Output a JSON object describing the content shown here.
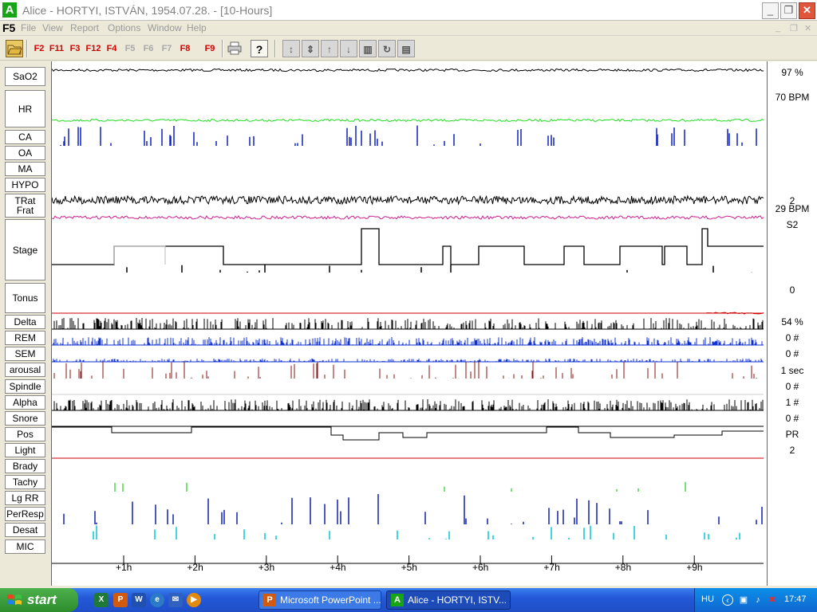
{
  "window": {
    "app_icon": "A",
    "title": "Alice - HORTYI, ISTVÁN, 1954.07.28.  - [10-Hours]",
    "minimize": "_",
    "maximize": "❐",
    "close": "✕"
  },
  "menu": {
    "f5": "F5",
    "items": [
      "File",
      "View",
      "Report",
      "Options",
      "Window",
      "Help"
    ],
    "mdi_controls": [
      "_",
      "❐",
      "✕"
    ]
  },
  "toolbar": {
    "open_icon": "folder-open-icon",
    "fkeys": [
      {
        "label": "F2",
        "enabled": true
      },
      {
        "label": "F11",
        "enabled": true
      },
      {
        "label": "F3",
        "enabled": true
      },
      {
        "label": "F12",
        "enabled": true
      },
      {
        "label": "F4",
        "enabled": true
      },
      {
        "label": "F5",
        "enabled": false
      },
      {
        "label": "F6",
        "enabled": false
      },
      {
        "label": "F7",
        "enabled": false
      },
      {
        "label": "F8",
        "enabled": true
      },
      {
        "label": "F9",
        "enabled": true
      }
    ],
    "print_icon": "printer-icon",
    "help_label": "?",
    "nav_icons": [
      "expand-icon",
      "compress-icon",
      "move-up-icon",
      "move-down-icon",
      "columns-icon",
      "refresh-icon",
      "layout-icon"
    ]
  },
  "channels": [
    {
      "label": "SaO2"
    },
    {
      "label": "HR"
    },
    {
      "label": "CA"
    },
    {
      "label": "OA"
    },
    {
      "label": "MA"
    },
    {
      "label": "HYPO"
    },
    {
      "label": "TRat\nFrat"
    },
    {
      "label": "Stage"
    },
    {
      "label": "Tonus"
    },
    {
      "label": "Delta"
    },
    {
      "label": "REM"
    },
    {
      "label": "SEM"
    },
    {
      "label": "arousal"
    },
    {
      "label": "Spindle"
    },
    {
      "label": "Alpha"
    },
    {
      "label": "Snore"
    },
    {
      "label": "Pos"
    },
    {
      "label": "Light"
    },
    {
      "label": "Brady"
    },
    {
      "label": "Tachy"
    },
    {
      "label": "Lg RR"
    },
    {
      "label": "PerResp"
    },
    {
      "label": "Desat"
    },
    {
      "label": "MIC"
    }
  ],
  "readouts": {
    "sao2": "97 %",
    "hr": "70 BPM",
    "trat_top": "2",
    "trat": "29 BPM",
    "stage": "S2",
    "tonus": "0",
    "delta": "54 %",
    "rem": "0 #",
    "sem": "0 #",
    "arousal": "1 sec",
    "spindle": "0 #",
    "alpha": "1 #",
    "snore": "0 #",
    "pos": "PR",
    "light": "2"
  },
  "time_axis": {
    "ticks": [
      "+1h",
      "+2h",
      "+3h",
      "+4h",
      "+5h",
      "+6h",
      "+7h",
      "+8h",
      "+9h"
    ]
  },
  "colors": {
    "sao2": "#000000",
    "hr": "#22dd22",
    "ca": "#1020c0",
    "trat": "#000000",
    "frat": "#cc2090",
    "stage": "#000000",
    "tonus": "#cc0000",
    "delta": "#000000",
    "rem": "#1030d0",
    "sem": "#1030d0",
    "arousal": "#8a1010",
    "alpha": "#000000",
    "tachy": "#22cc22",
    "lgrr": "#1020b0",
    "desat": "#00c8d8"
  },
  "taskbar": {
    "start": "start",
    "quick_launch": [
      "excel-icon",
      "powerpoint-icon",
      "word-icon",
      "network-icon",
      "outlook-icon",
      "media-player-icon"
    ],
    "tasks": [
      {
        "label": "Microsoft PowerPoint ...",
        "icon": "P"
      },
      {
        "label": "Alice - HORTYI, ISTV...",
        "icon": "A"
      }
    ],
    "language": "HU",
    "clock": "17:47"
  }
}
